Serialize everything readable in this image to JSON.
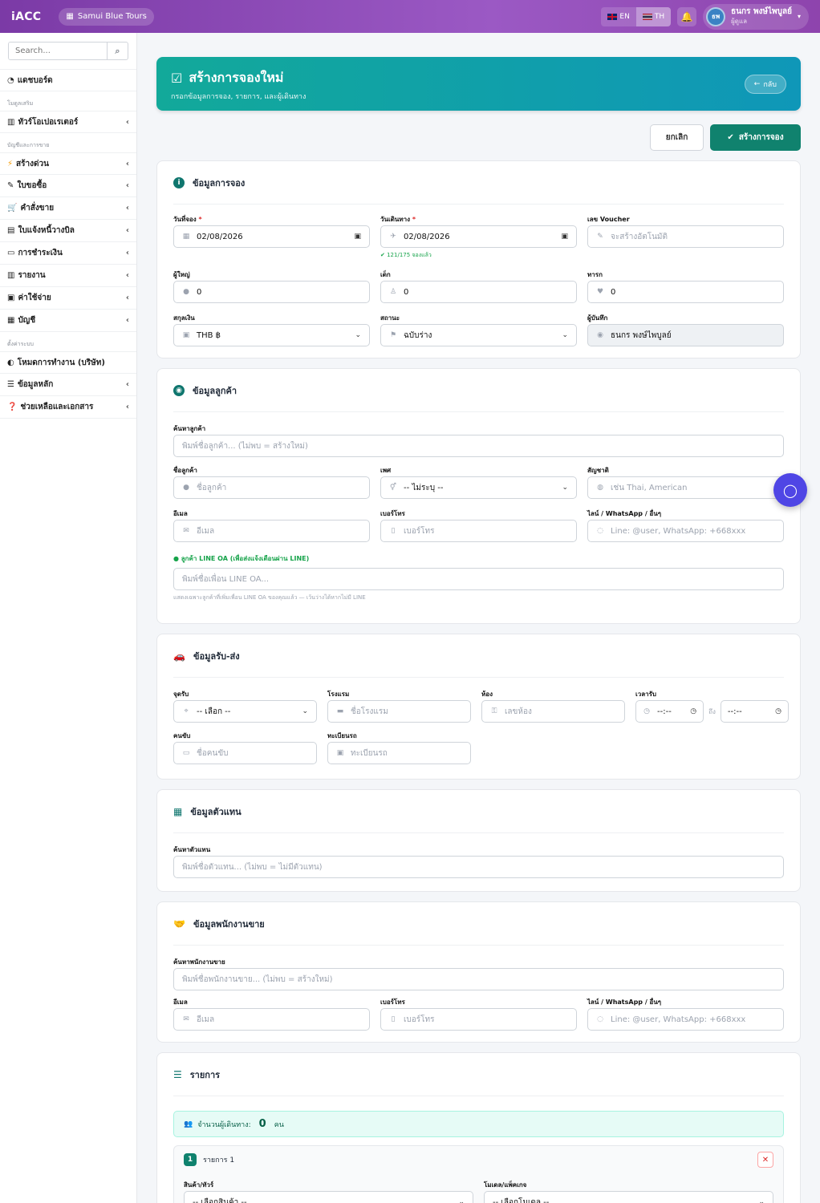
{
  "topbar": {
    "brand": "iACC",
    "company": "Samui Blue Tours",
    "lang_en": "EN",
    "lang_th": "TH",
    "user_initials": "ธพ",
    "user_name": "ธนกร พงษ์ไพบูลย์",
    "user_role": "ผู้ดูแล"
  },
  "sidebar": {
    "search_placeholder": "Search...",
    "dashboard": "แดชบอร์ด",
    "section_addon": "โมดูลเสริม",
    "tour_operator": "ทัวร์โอเปอเรเตอร์",
    "section_accounting": "บัญชีและการขาย",
    "items": [
      {
        "label": "สร้างด่วน",
        "icon": "⚡"
      },
      {
        "label": "ใบขอซื้อ",
        "icon": "✎"
      },
      {
        "label": "คำสั่งขาย",
        "icon": "🛒"
      },
      {
        "label": "ใบแจ้งหนี้วางบิล",
        "icon": "▤"
      },
      {
        "label": "การชำระเงิน",
        "icon": "▭"
      },
      {
        "label": "รายงาน",
        "icon": "▥"
      },
      {
        "label": "ค่าใช้จ่าย",
        "icon": "▣"
      },
      {
        "label": "บัญชี",
        "icon": "▦"
      }
    ],
    "section_settings": "ตั้งค่าระบบ",
    "work_mode": "โหมดการทำงาน (บริษัท)",
    "master_data": "ข้อมูลหลัก",
    "help": "ช่วยเหลือและเอกสาร"
  },
  "banner": {
    "title": "สร้างการจองใหม่",
    "subtitle": "กรอกข้อมูลการจอง, รายการ, และผู้เดินทาง",
    "back": "กลับ"
  },
  "actions": {
    "cancel": "ยกเลิก",
    "create": "สร้างการจอง"
  },
  "booking": {
    "title": "ข้อมูลการจอง",
    "booking_date_label": "วันที่จอง",
    "booking_date": "02/08/2026",
    "travel_date_label": "วันเดินทาง",
    "travel_date": "02/08/2026",
    "capacity_hint": "121/175 จองแล้ว",
    "voucher_label": "เลข Voucher",
    "voucher_placeholder": "จะสร้างอัตโนมัติ",
    "adults_label": "ผู้ใหญ่",
    "adults": "0",
    "children_label": "เด็ก",
    "children": "0",
    "infants_label": "ทารก",
    "infants": "0",
    "currency_label": "สกุลเงิน",
    "currency": "THB ฿",
    "status_label": "สถานะ",
    "status": "ฉบับร่าง",
    "recorder_label": "ผู้บันทึก",
    "recorder": "ธนกร พงษ์ไพบูลย์"
  },
  "customer": {
    "title": "ข้อมูลลูกค้า",
    "search_label": "ค้นหาลูกค้า",
    "search_placeholder": "พิมพ์ชื่อลูกค้า... (ไม่พบ = สร้างใหม่)",
    "name_label": "ชื่อลูกค้า",
    "name_placeholder": "ชื่อลูกค้า",
    "gender_label": "เพศ",
    "gender": "-- ไม่ระบุ --",
    "nationality_label": "สัญชาติ",
    "nationality_placeholder": "เช่น Thai, American",
    "email_label": "อีเมล",
    "email_placeholder": "อีเมล",
    "phone_label": "เบอร์โทร",
    "phone_placeholder": "เบอร์โทร",
    "line_label": "ไลน์ / WhatsApp / อื่นๆ",
    "line_placeholder": "Line: @user, WhatsApp: +668xxx",
    "oa_label": "ลูกค้า LINE OA (เพื่อส่งแจ้งเตือนผ่าน LINE)",
    "oa_placeholder": "พิมพ์ชื่อเพื่อน LINE OA...",
    "oa_hint": "แสดงเฉพาะลูกค้าที่เพิ่มเพื่อน LINE OA ของคุณแล้ว — เว้นว่างได้หากไม่มี LINE"
  },
  "transfer": {
    "title": "ข้อมูลรับ-ส่ง",
    "pickup_label": "จุดรับ",
    "pickup": "-- เลือก --",
    "hotel_label": "โรงแรม",
    "hotel_placeholder": "ชื่อโรงแรม",
    "room_label": "ห้อง",
    "room_placeholder": "เลขห้อง",
    "time_label": "เวลารับ",
    "time_from": "--:--",
    "time_to_sep": "ถึง",
    "time_to": "--:--",
    "driver_label": "คนขับ",
    "driver_placeholder": "ชื่อคนขับ",
    "plate_label": "ทะเบียนรถ",
    "plate_placeholder": "ทะเบียนรถ"
  },
  "agent": {
    "title": "ข้อมูลตัวแทน",
    "search_label": "ค้นหาตัวแทน",
    "search_placeholder": "พิมพ์ชื่อตัวแทน... (ไม่พบ = ไม่มีตัวแทน)"
  },
  "sales": {
    "title": "ข้อมูลพนักงานขาย",
    "search_label": "ค้นหาพนักงานขาย",
    "search_placeholder": "พิมพ์ชื่อพนักงานขาย... (ไม่พบ = สร้างใหม่)",
    "email_label": "อีเมล",
    "email_placeholder": "อีเมล",
    "phone_label": "เบอร์โทร",
    "phone_placeholder": "เบอร์โทร",
    "line_label": "ไลน์ / WhatsApp / อื่นๆ",
    "line_placeholder": "Line: @user, WhatsApp: +668xxx"
  },
  "items": {
    "title": "รายการ",
    "pax_label": "จำนวนผู้เดินทาง:",
    "pax_count": "0",
    "pax_unit": "คน",
    "item_no": "1",
    "item_title": "รายการ 1",
    "product_label": "สินค้า/ทัวร์",
    "product": "-- เลือกสินค้า --",
    "model_label": "โมเดล/แพ็คเกจ",
    "model": "-- เลือกโมเดล --"
  },
  "colors": {
    "topbar": "#8e44ad",
    "banner": "#12a99a",
    "primary": "#10826e",
    "chat": "#4f46e5"
  }
}
